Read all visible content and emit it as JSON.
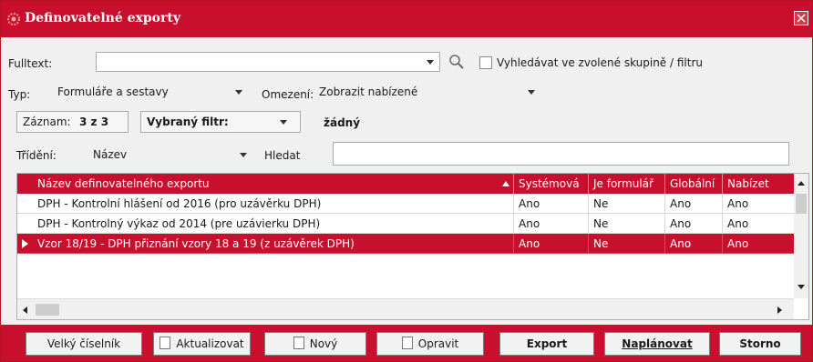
{
  "window": {
    "title": "Definovatelné exporty"
  },
  "fulltext": {
    "label": "Fulltext:",
    "value": "",
    "checkbox_label": "Vyhledávat ve zvolené skupině / filtru",
    "checkbox_checked": false
  },
  "typ": {
    "label": "Typ:",
    "value": "Formuláře a sestavy"
  },
  "omezeni": {
    "label": "Omezení:",
    "value": "Zobrazit nabízené"
  },
  "zaznam": {
    "label": "Záznam:",
    "value": "3 z 3"
  },
  "filtr": {
    "label": "Vybraný filtr:",
    "value": "žádný"
  },
  "trideni": {
    "label": "Třídění:",
    "value": "Název"
  },
  "hledat": {
    "label": "Hledat",
    "value": ""
  },
  "grid": {
    "columns": [
      "Název definovatelného exportu",
      "Systémová",
      "Je formulář",
      "Globální",
      "Nabízet"
    ],
    "sorted_column": "Název definovatelného exportu",
    "rows": [
      {
        "name": "DPH - Kontrolní hlášení od 2016 (pro uzávěrku DPH)",
        "systemova": "Ano",
        "formular": "Ne",
        "globalni": "Ano",
        "nabizet": "Ano",
        "selected": false
      },
      {
        "name": "DPH - Kontrolný výkaz od 2014 (pre uzávierku DPH)",
        "systemova": "Ano",
        "formular": "Ne",
        "globalni": "Ano",
        "nabizet": "Ano",
        "selected": false
      },
      {
        "name": "Vzor 18/19 - DPH přiznání vzory 18 a 19 (z uzávěrek DPH)",
        "systemova": "Ano",
        "formular": "Ne",
        "globalni": "Ano",
        "nabizet": "Ano",
        "selected": true
      }
    ]
  },
  "buttons": {
    "velky_ciselnik": "Velký číselník",
    "aktualizovat": "Aktualizovat",
    "novy": "Nový",
    "opravit": "Opravit",
    "export": "Export",
    "naplanovat": "Naplánovat",
    "storno": "Storno"
  },
  "colors": {
    "accent": "#c8102e",
    "background": "#f0f0f0"
  },
  "icons": [
    "app-logo-icon",
    "close-icon",
    "search-icon",
    "sort-ascending-icon",
    "row-pointer-icon",
    "refresh-icon",
    "new-document-icon",
    "edit-icon"
  ]
}
